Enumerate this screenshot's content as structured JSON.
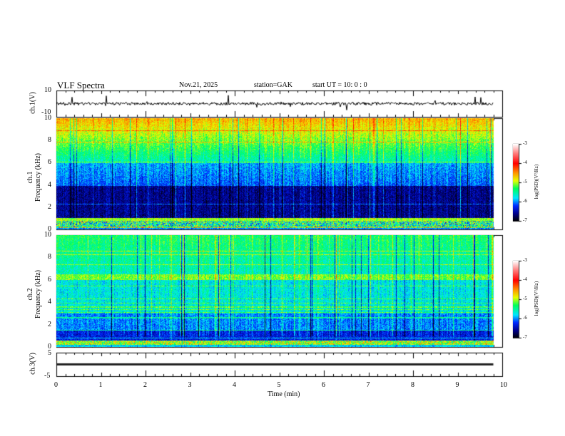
{
  "header": {
    "title": "VLF  Spectra",
    "date": "Nov.21, 2025",
    "station": "station=GAK",
    "start": "start  UT  =    10: 0   : 0"
  },
  "chart_data": [
    {
      "type": "line",
      "name": "ch1 waveform",
      "ylabel": "ch.1(V)",
      "ylim": [
        -10,
        10
      ],
      "yticks": [
        "10",
        "-10"
      ],
      "x_range_min": [
        0,
        9.8
      ],
      "baseline": 0
    },
    {
      "type": "heatmap",
      "name": "ch1 spectrogram",
      "ylabel": "ch.1\nFrequency  (kHz)",
      "ylabel_line1": "ch.1",
      "ylabel_line2": "Frequency  (kHz)",
      "ylim": [
        0,
        10
      ],
      "yticks": [
        "10",
        "8",
        "6",
        "4",
        "2",
        "0"
      ],
      "colorbar": {
        "label": "log(PSD)(V²/Hz)",
        "range": [
          -7,
          -3
        ],
        "ticks": [
          "-3",
          "-4",
          "-5",
          "-6",
          "-7"
        ]
      }
    },
    {
      "type": "heatmap",
      "name": "ch2 spectrogram",
      "ylabel_line1": "ch.2",
      "ylabel_line2": "Frequency  (kHz)",
      "ylim": [
        0,
        10
      ],
      "yticks": [
        "10",
        "8",
        "6",
        "4",
        "2",
        "0"
      ],
      "colorbar": {
        "label": "log(PSD)(V²/Hz)",
        "range": [
          -7,
          -3
        ],
        "ticks": [
          "-3",
          "-4",
          "-5",
          "-6",
          "-7"
        ]
      }
    },
    {
      "type": "line",
      "name": "ch3 waveform",
      "ylabel": "ch.3(V)",
      "ylim": [
        -5,
        5
      ],
      "yticks": [
        "5",
        "-5"
      ],
      "baseline": -1
    }
  ],
  "xaxis": {
    "label": "Time  (min)",
    "ticks": [
      "0",
      "1",
      "2",
      "3",
      "4",
      "5",
      "6",
      "7",
      "8",
      "9",
      "10"
    ],
    "range": [
      0,
      10
    ]
  }
}
